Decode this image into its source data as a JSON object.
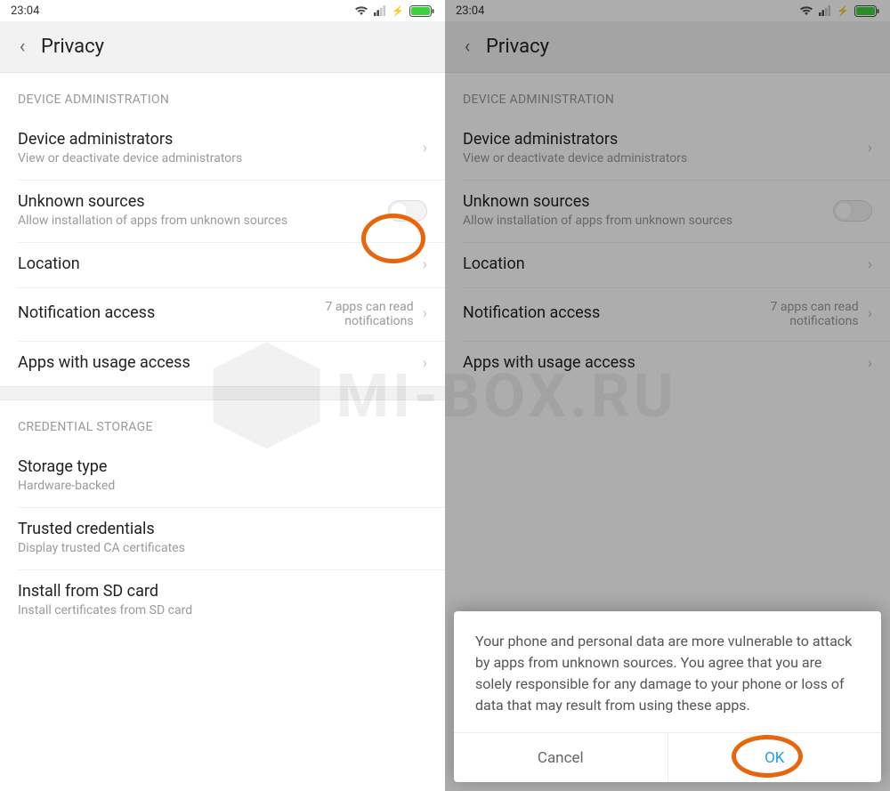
{
  "status": {
    "time": "23:04"
  },
  "header": {
    "title": "Privacy"
  },
  "sections": {
    "device_admin_label": "DEVICE ADMINISTRATION",
    "credential_label": "CREDENTIAL STORAGE",
    "rows": {
      "device_admins": {
        "title": "Device administrators",
        "sub": "View or deactivate device administrators"
      },
      "unknown_sources": {
        "title": "Unknown sources",
        "sub": "Allow installation of apps from unknown sources"
      },
      "location": {
        "title": "Location"
      },
      "notif_access": {
        "title": "Notification access",
        "value": "7 apps can read notifications"
      },
      "usage_access": {
        "title": "Apps with usage access"
      },
      "storage_type": {
        "title": "Storage type",
        "sub": "Hardware-backed"
      },
      "trusted_creds": {
        "title": "Trusted credentials",
        "sub": "Display trusted CA certificates"
      },
      "install_sd": {
        "title": "Install from SD card",
        "sub": "Install certificates from SD card"
      }
    }
  },
  "dialog": {
    "body": "Your phone and personal data are more vulnerable to attack by apps from unknown sources. You agree that you are solely responsible for any damage to your phone or loss of data that may result from using these apps.",
    "cancel": "Cancel",
    "ok": "OK"
  },
  "watermark": "MI-BOX.RU"
}
